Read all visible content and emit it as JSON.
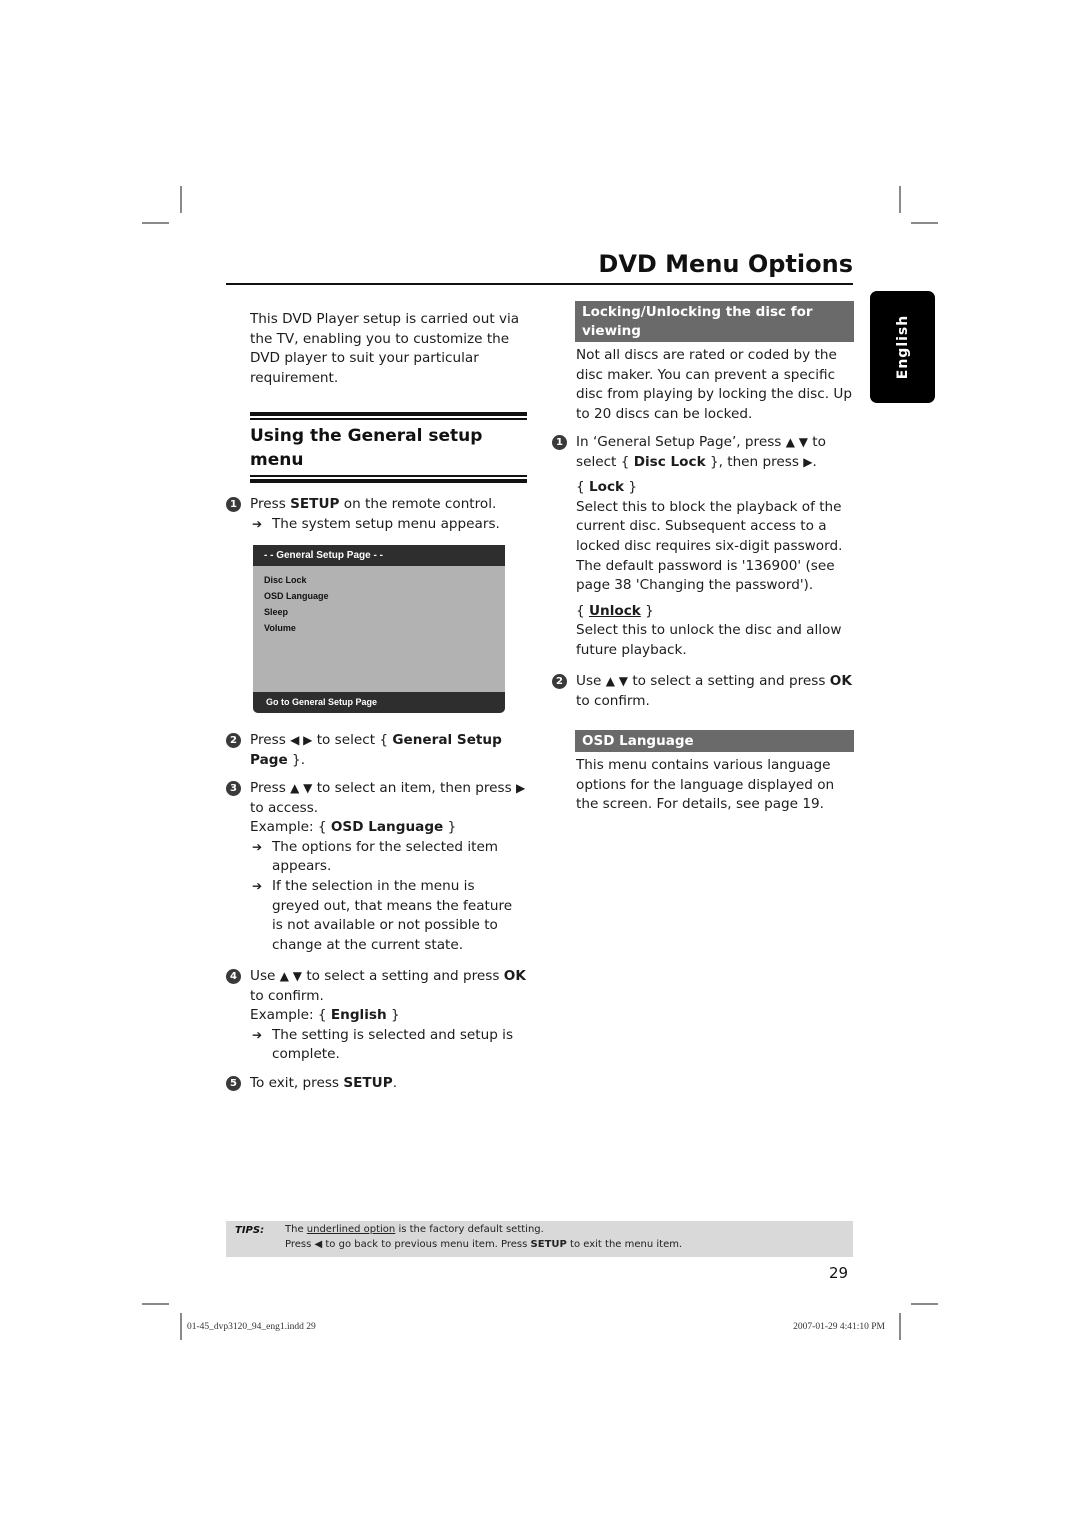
{
  "page": {
    "title": "DVD Menu Options",
    "page_number": "29",
    "language_tab": "English"
  },
  "left_column": {
    "intro": "This DVD Player setup is carried out via the TV, enabling you to customize the DVD player to suit your particular requirement.",
    "section_heading": "Using the General setup menu",
    "steps": [
      {
        "number": "1",
        "parts": {
          "a": "Press ",
          "b": "SETUP",
          "c": " on the remote control."
        },
        "results": [
          "The system setup menu appears."
        ]
      },
      {
        "number": "2",
        "parts": {
          "a": "Press ",
          "icons": "◀ ▶",
          "b": " to select { ",
          "c": "General Setup Page",
          "d": " }."
        }
      },
      {
        "number": "3",
        "parts": {
          "a": "Press ",
          "icons": "▲ ▼",
          "b": " to select an item, then press ",
          "icon2": "▶",
          "c": " to access."
        },
        "example_prefix": "Example: { ",
        "example_value": "OSD Language",
        "example_suffix": " }",
        "results": [
          "The options for the selected item appears.",
          "If the selection in the menu is greyed out, that means the feature is not available or not possible to change at the current state."
        ]
      },
      {
        "number": "4",
        "parts": {
          "a": "Use ",
          "icons": "▲ ▼",
          "b": " to select a setting and press ",
          "c": "OK",
          "d": " to confirm."
        },
        "example_prefix": "Example: { ",
        "example_value": "English",
        "example_suffix": " }",
        "results": [
          "The setting is selected and setup is complete."
        ]
      },
      {
        "number": "5",
        "parts": {
          "a": "To exit, press ",
          "b": "SETUP",
          "c": "."
        }
      }
    ],
    "setup_menu": {
      "header": "- -   General Setup Page   - -",
      "items": [
        "Disc Lock",
        "OSD Language",
        "Sleep",
        "Volume"
      ],
      "footer": "Go to General Setup Page"
    }
  },
  "right_column": {
    "lock_heading": "Locking/Unlocking the disc for viewing",
    "lock_intro": "Not all discs are rated or coded by the disc maker. You can prevent a specific disc from playing by locking the disc. Up to 20 discs can be locked.",
    "lock_steps": [
      {
        "number": "1",
        "parts": {
          "a": "In ‘General Setup Page’, press ",
          "icons": "▲ ▼",
          "b": " to select { ",
          "c": "Disc Lock",
          "d": " }, then press ",
          "icon2": "▶",
          "e": "."
        },
        "options": [
          {
            "label": "Lock",
            "underlined": false,
            "description": "Select this to block the playback of the current disc. Subsequent access to a locked disc requires six-digit password. The default password is '136900' (see page 38 'Changing the password')."
          },
          {
            "label": "Unlock",
            "underlined": true,
            "description": "Select this to unlock the disc and allow future playback."
          }
        ]
      },
      {
        "number": "2",
        "parts": {
          "a": "Use ",
          "icons": "▲ ▼",
          "b": " to select a setting and press ",
          "c": "OK",
          "d": " to confirm."
        }
      }
    ],
    "osd_heading": "OSD Language",
    "osd_desc": "This menu contains various language options for the language displayed on the screen. For details, see page 19."
  },
  "tips": {
    "label": "TIPS:",
    "line1_a": "The ",
    "line1_underlined": "underlined option",
    "line1_b": " is the factory default setting.",
    "line2_a": "Press ",
    "line2_icon": "◀",
    "line2_b": " to go back to previous menu item. Press ",
    "line2_bold": "SETUP",
    "line2_c": " to exit the menu item."
  },
  "print_meta": {
    "file": "01-45_dvp3120_94_eng1.indd   29",
    "date": "2007-01-29   4:41:10 PM"
  },
  "glyphs": {
    "arrow": "➔",
    "brace_open": "{ ",
    "brace_close": " }"
  }
}
